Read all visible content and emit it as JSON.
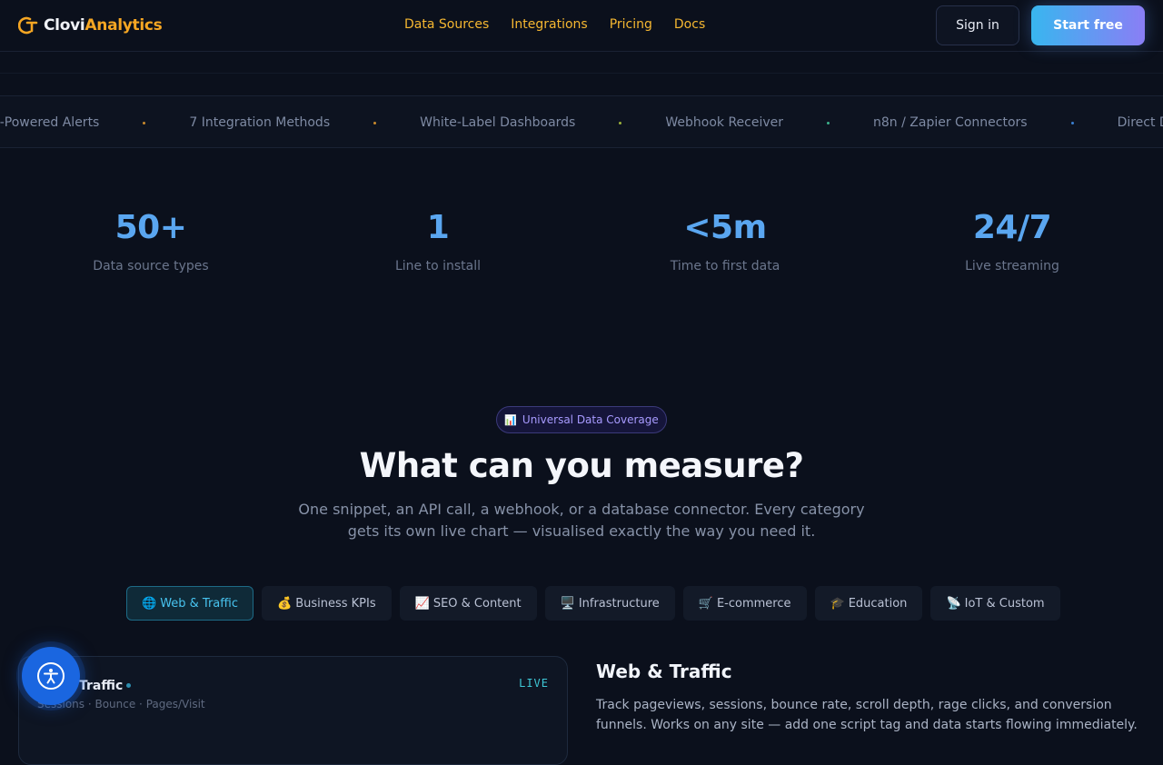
{
  "brand": {
    "name_prefix": "Clovi",
    "name_suffix": "Analytics",
    "accent": "#f5a623"
  },
  "nav": {
    "links": [
      "Data Sources",
      "Integrations",
      "Pricing",
      "Docs"
    ],
    "signin_label": "Sign in",
    "cta_label": "Start free"
  },
  "ticker": {
    "items": [
      {
        "label": "AI-Powered Alerts",
        "dot_color": "#c98a2c"
      },
      {
        "label": "7 Integration Methods",
        "dot_color": "#c98a2c"
      },
      {
        "label": "White-Label Dashboards",
        "dot_color": "#9ab03a"
      },
      {
        "label": "Webhook Receiver",
        "dot_color": "#3bb08a"
      },
      {
        "label": "n8n / Zapier Connectors",
        "dot_color": "#3a7fd0"
      },
      {
        "label": "Direct DB",
        "dot_color": ""
      }
    ]
  },
  "stats": [
    {
      "value": "50+",
      "label": "Data source types"
    },
    {
      "value": "1",
      "label": "Line to install"
    },
    {
      "value": "<5m",
      "label": "Time to first data"
    },
    {
      "value": "24/7",
      "label": "Live streaming"
    }
  ],
  "section": {
    "badge_icon": "📊",
    "badge": "Universal Data Coverage",
    "title": "What can you measure?",
    "subtitle": "One snippet, an API call, a webhook, or a database connector. Every category gets its own live chart — visualised exactly the way you need it."
  },
  "tabs": [
    {
      "icon": "🌐",
      "label": "Web & Traffic",
      "active": true
    },
    {
      "icon": "💰",
      "label": "Business KPIs",
      "active": false
    },
    {
      "icon": "📈",
      "label": "SEO & Content",
      "active": false
    },
    {
      "icon": "🖥️",
      "label": "Infrastructure",
      "active": false
    },
    {
      "icon": "🛒",
      "label": "E-commerce",
      "active": false
    },
    {
      "icon": "🎓",
      "label": "Education",
      "active": false
    },
    {
      "icon": "📡",
      "label": "IoT & Custom",
      "active": false
    }
  ],
  "card": {
    "title": "Traffic",
    "subtitle": "Sessions · Bounce · Pages/Visit",
    "live_label": "LIVE"
  },
  "detail": {
    "title": "Web & Traffic",
    "text": "Track pageviews, sessions, bounce rate, scroll depth, rage clicks, and conversion funnels. Works on any site — add one script tag and data starts flowing immediately."
  }
}
